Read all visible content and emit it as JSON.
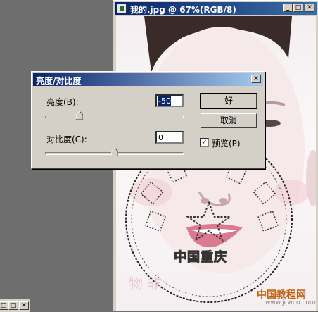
{
  "document": {
    "title": "我的.jpg @ 67%(RGB/8)",
    "stamp_text_center": "中国重庆",
    "stamp_text_bottom": "物    非",
    "watermark_text": "中国教程网",
    "watermark_url": "www.jcwcn.com"
  },
  "dialog": {
    "title": "亮度/对比度",
    "brightness": {
      "label": "亮度(B):",
      "value": "-50",
      "slider_value": -50,
      "min": -100,
      "max": 100
    },
    "contrast": {
      "label": "对比度(C):",
      "value": "0",
      "slider_value": 0,
      "min": -100,
      "max": 100
    },
    "ok_label": "好",
    "cancel_label": "取消",
    "preview_label": "预览(P)",
    "preview_checked": true
  },
  "window_buttons": {
    "minimize": "_",
    "maximize": "□",
    "close": "✕"
  }
}
